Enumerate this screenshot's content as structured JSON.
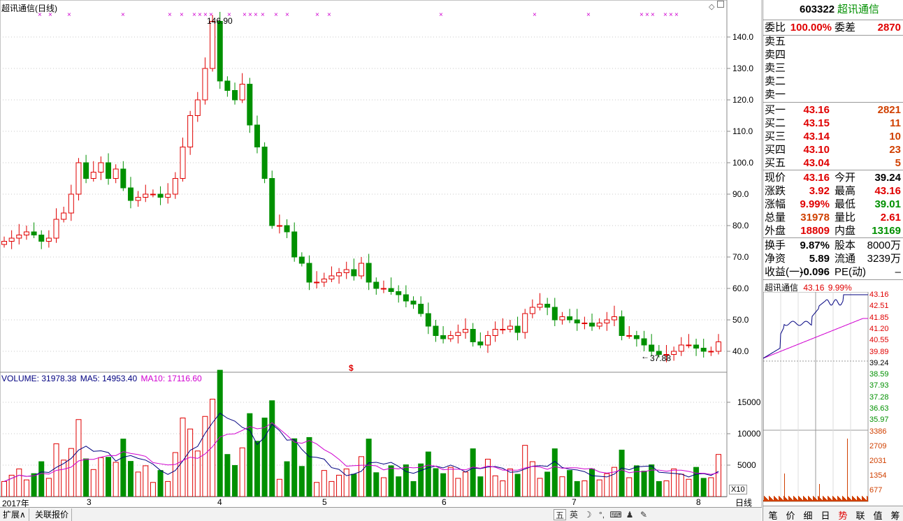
{
  "header": {
    "title": "超讯通信(日线)",
    "high_label": "146.90",
    "low_label": "37.88",
    "date_start": "2017年"
  },
  "price_axis": [
    "140.0",
    "130.0",
    "120.0",
    "110.0",
    "100.0",
    "90.0",
    "80.0",
    "70.0",
    "60.0",
    "50.0",
    "40.0"
  ],
  "volume_axis": [
    "15000",
    "10000",
    "5000"
  ],
  "volume_legend": {
    "volume": "VOLUME: 31978.38",
    "ma5": "MA5: 14953.40",
    "ma10": "MA10: 17116.60"
  },
  "months": [
    "3",
    "4",
    "5",
    "6",
    "7",
    "8"
  ],
  "unit_label": "X10",
  "period_label": "日线",
  "bottom_tabs": [
    "扩展∧",
    "关联报价"
  ],
  "toolbar_icons": [
    "五",
    "英",
    "☽",
    "⌨",
    "♟",
    "✎"
  ],
  "chart_data": {
    "type": "candlestick",
    "title": "超讯通信(日线)",
    "ylim": [
      36,
      148
    ],
    "volume_ylim": [
      0,
      19000
    ],
    "price_path": [
      75,
      76,
      77,
      78,
      77,
      75,
      76,
      82,
      84,
      90,
      100,
      95,
      97,
      100,
      95,
      98,
      92,
      88,
      89,
      90,
      90,
      89,
      90,
      95,
      105,
      115,
      120,
      130,
      145,
      126,
      123,
      120,
      125,
      112,
      105,
      95,
      80,
      80,
      78,
      70,
      68,
      62,
      62,
      63,
      64,
      65,
      66,
      64,
      68,
      62,
      60,
      60,
      59,
      58,
      56,
      55,
      52,
      48,
      45,
      44,
      45,
      46,
      47,
      43,
      42,
      45,
      47,
      47,
      48,
      46,
      52,
      54,
      55,
      54,
      50,
      51,
      50,
      49,
      49,
      48,
      49,
      50,
      51,
      45,
      45,
      44,
      42,
      40,
      39,
      39,
      40,
      42,
      42,
      41,
      40,
      40,
      43
    ],
    "up_color": "#e00000",
    "down_color": "#009000",
    "ma5_color": "#000080",
    "ma10_color": "#d000d0"
  },
  "quote": {
    "code": "603322",
    "name": "超讯通信",
    "weibi_label": "委比",
    "weibi": "100.00%",
    "weicha_label": "委差",
    "weicha": "2870",
    "sells": [
      {
        "label": "卖五"
      },
      {
        "label": "卖四"
      },
      {
        "label": "卖三"
      },
      {
        "label": "卖二"
      },
      {
        "label": "卖一"
      }
    ],
    "buys": [
      {
        "label": "买一",
        "price": "43.16",
        "vol": "2821"
      },
      {
        "label": "买二",
        "price": "43.15",
        "vol": "11"
      },
      {
        "label": "买三",
        "price": "43.14",
        "vol": "10"
      },
      {
        "label": "买四",
        "price": "43.10",
        "vol": "23"
      },
      {
        "label": "买五",
        "price": "43.04",
        "vol": "5"
      }
    ],
    "stats": [
      {
        "l1": "现价",
        "v1": "43.16",
        "c1": "red",
        "l2": "今开",
        "v2": "39.24",
        "c2": ""
      },
      {
        "l1": "涨跌",
        "v1": "3.92",
        "c1": "red",
        "l2": "最高",
        "v2": "43.16",
        "c2": "red"
      },
      {
        "l1": "涨幅",
        "v1": "9.99%",
        "c1": "red",
        "l2": "最低",
        "v2": "39.01",
        "c2": "green"
      },
      {
        "l1": "总量",
        "v1": "31978",
        "c1": "orange",
        "l2": "量比",
        "v2": "2.61",
        "c2": "red"
      },
      {
        "l1": "外盘",
        "v1": "18809",
        "c1": "red",
        "l2": "内盘",
        "v2": "13169",
        "c2": "green"
      }
    ],
    "stats2": [
      {
        "l1": "换手",
        "v1": "9.87%",
        "l2": "股本",
        "v2": "8000万"
      },
      {
        "l1": "净资",
        "v1": "5.89",
        "l2": "流通",
        "v2": "3239万"
      },
      {
        "l1": "收益(一)",
        "v1": "-0.096",
        "l2": "PE(动)",
        "v2": "–"
      }
    ]
  },
  "mini_chart": {
    "name": "超讯通信",
    "price": "43.16",
    "pct": "9.99%",
    "price_ticks": [
      "43.16",
      "42.51",
      "41.85",
      "41.20",
      "40.55",
      "39.89",
      "39.24",
      "38.59",
      "37.93",
      "37.28",
      "36.63",
      "35.97"
    ],
    "vol_ticks": [
      "3386",
      "2709",
      "2031",
      "1354",
      "677"
    ]
  },
  "right_tabs": [
    "笔",
    "价",
    "细",
    "日",
    "势",
    "联",
    "值",
    "筹"
  ]
}
